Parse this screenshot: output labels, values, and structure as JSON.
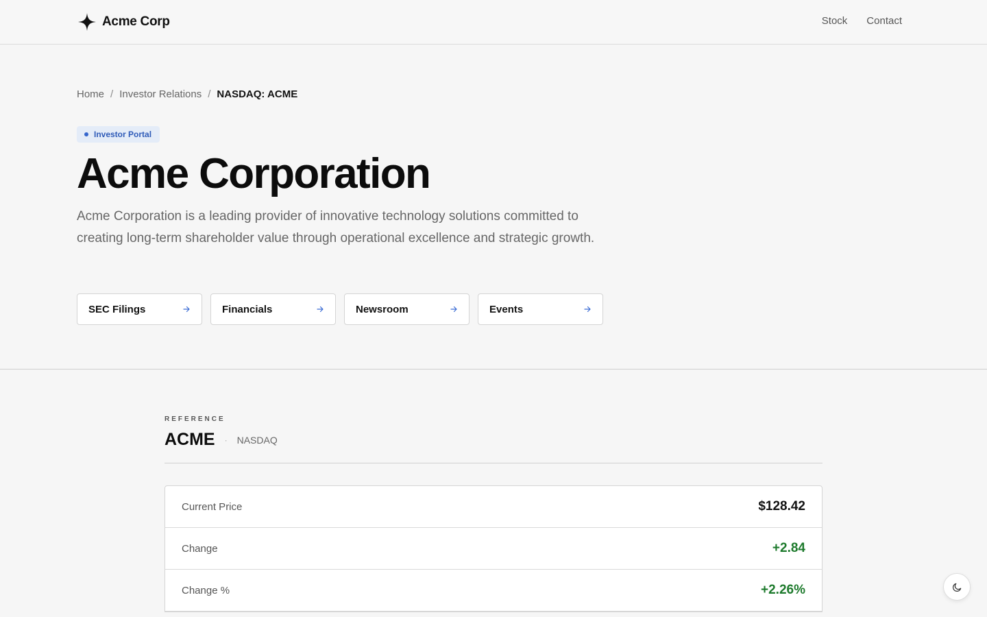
{
  "header": {
    "brand_name": "Acme Corp",
    "nav": [
      {
        "label": "Stock"
      },
      {
        "label": "Contact"
      }
    ]
  },
  "hero": {
    "breadcrumb": {
      "home": "Home",
      "section": "Investor Relations",
      "current": "NASDAQ: ACME",
      "separator": "/"
    },
    "badge": "Investor Portal",
    "title": "Acme Corporation",
    "description": "Acme Corporation is a leading provider of innovative technology solutions committed to creating long-term shareholder value through operational excellence and strategic growth.",
    "quick_links": [
      {
        "label": "SEC Filings"
      },
      {
        "label": "Financials"
      },
      {
        "label": "Newsroom"
      },
      {
        "label": "Events"
      }
    ]
  },
  "stock": {
    "eyebrow": "REFERENCE",
    "ticker": "ACME",
    "separator": "·",
    "exchange": "NASDAQ",
    "rows": [
      {
        "label": "Current Price",
        "value": "$128.42"
      },
      {
        "label": "Change",
        "value": "+2.84"
      },
      {
        "label": "Change %",
        "value": "+2.26%"
      }
    ]
  },
  "colors": {
    "accent": "#2f5bb8",
    "positive": "#1d7a2c",
    "text": "#111111",
    "muted": "#666666"
  },
  "icons": {
    "brand": "four-point-star-icon",
    "link_arrow": "arrow-right-icon",
    "theme": "moon-icon"
  }
}
